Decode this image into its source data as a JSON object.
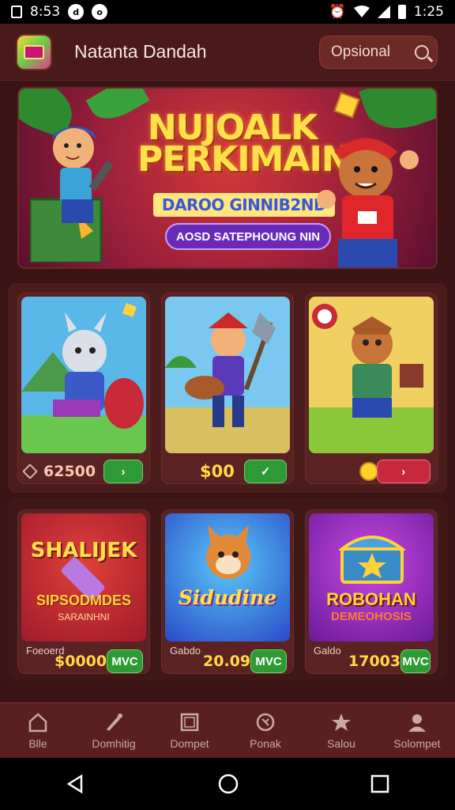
{
  "status_bar": {
    "time_left": "8:53",
    "time_right": "1:25"
  },
  "app_bar": {
    "title": "Natanta Dandah",
    "search_label": "Opsional"
  },
  "banner": {
    "title": "NUJOALK PERKIMAIN!",
    "subtitle": "DAROO GINNIB2ND",
    "pill_text": "AOSD SATEPHOUNG NIN"
  },
  "games_row1": [
    {
      "price": "62500",
      "button": "›",
      "button_color": "#2e9a36"
    },
    {
      "price": "$00",
      "button": "✓",
      "button_color": "#2e9a36"
    },
    {
      "price": "",
      "button": "›",
      "button_color": "#c8283e"
    }
  ],
  "games_row2": [
    {
      "thumb_title": "SHALIJEK",
      "thumb_sub": "SIPSODMDES",
      "thumb_sub2": "SARAINHNI",
      "label": "Foeoerd",
      "price": "$0000",
      "button": "MVC"
    },
    {
      "thumb_title": "Sidudine",
      "label": "Gabdo",
      "price": "20.09",
      "button": "MVC"
    },
    {
      "thumb_title": "ROBOHAN",
      "thumb_sub": "DEMEOHOSIS",
      "label": "Galdo",
      "price": "17003",
      "button": "MVC"
    }
  ],
  "bottom_nav": [
    {
      "label": "Blle",
      "icon": "home-icon"
    },
    {
      "label": "Domhitig",
      "icon": "brush-icon"
    },
    {
      "label": "Dompet",
      "icon": "wallet-icon"
    },
    {
      "label": "Ponak",
      "icon": "refresh-icon"
    },
    {
      "label": "Salou",
      "icon": "star-icon"
    },
    {
      "label": "Solompet",
      "icon": "profile-icon"
    }
  ],
  "colors": {
    "background": "#3a1414",
    "accent_gold": "#ffd94a",
    "button_green": "#2e9a36",
    "button_red": "#c8283e"
  }
}
